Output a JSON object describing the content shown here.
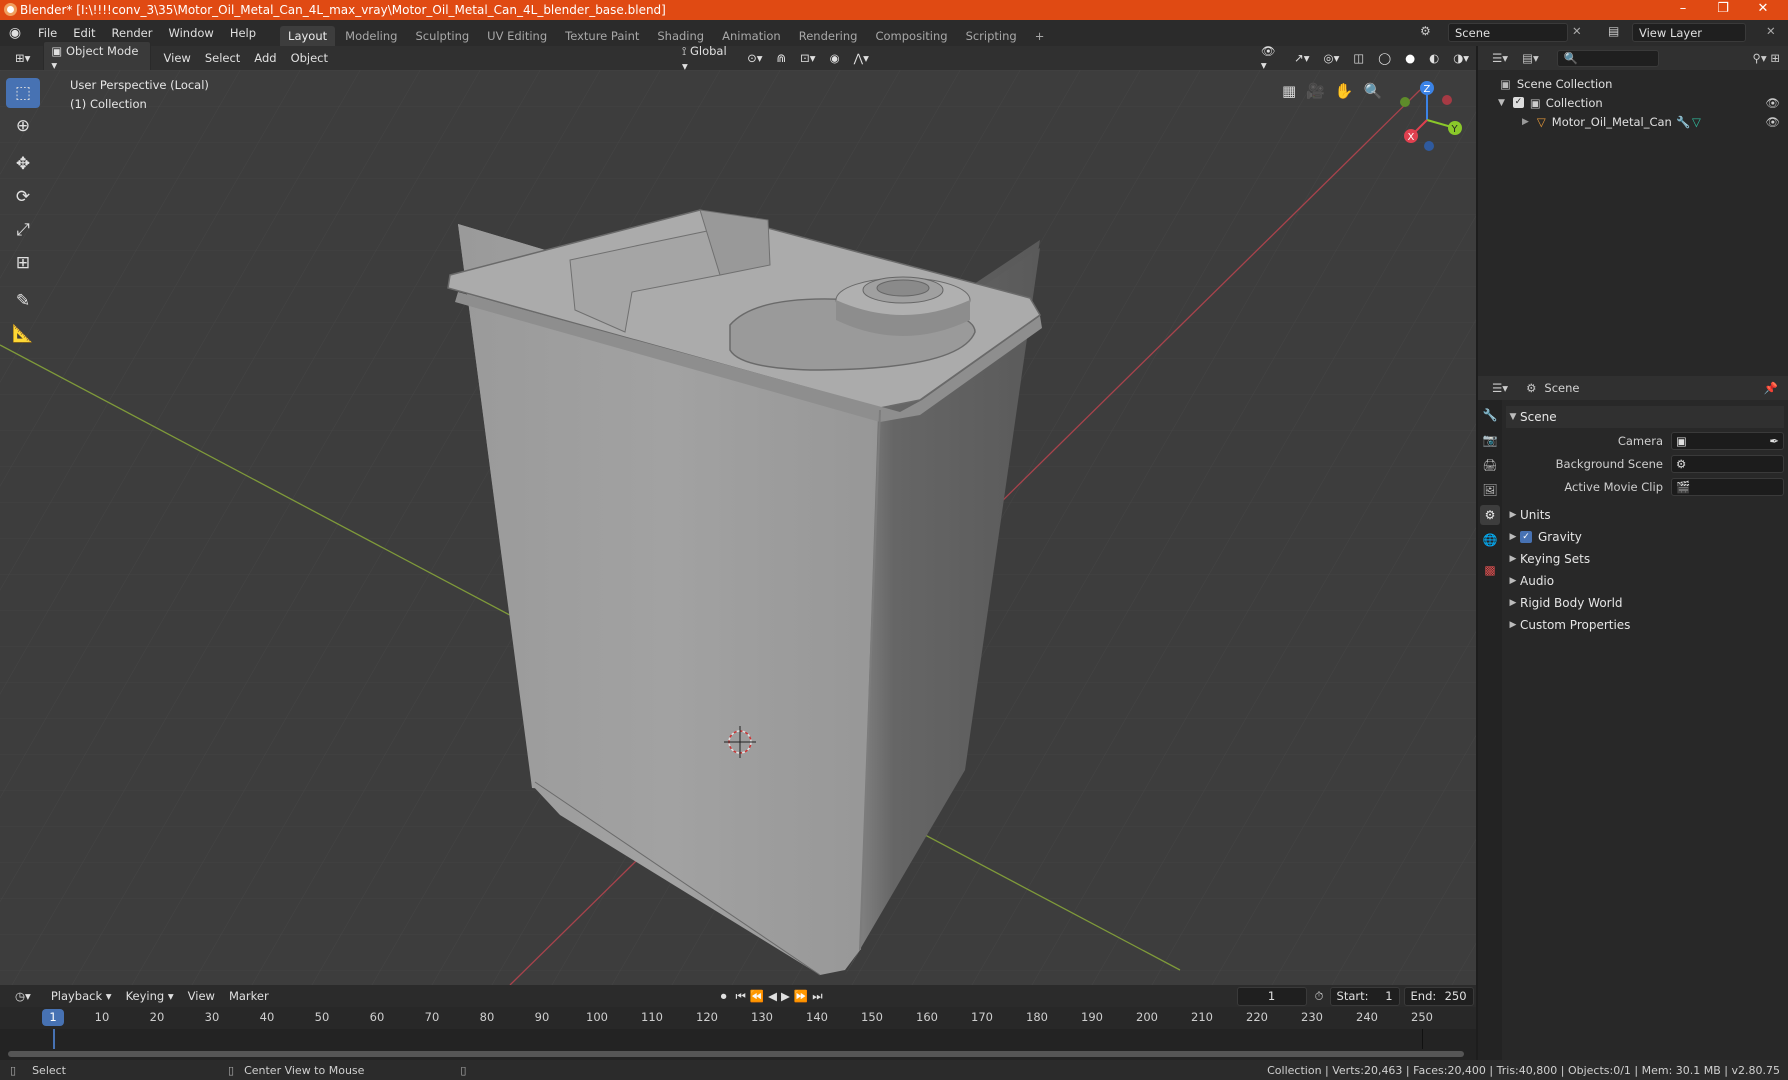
{
  "window": {
    "title": "Blender* [I:\\!!!!conv_3\\35\\Motor_Oil_Metal_Can_4L_max_vray\\Motor_Oil_Metal_Can_4L_blender_base.blend]",
    "minimize": "–",
    "maximize": "❐",
    "close": "✕"
  },
  "menu": {
    "items": [
      "File",
      "Edit",
      "Render",
      "Window",
      "Help"
    ]
  },
  "workspaces": {
    "tabs": [
      "Layout",
      "Modeling",
      "Sculpting",
      "UV Editing",
      "Texture Paint",
      "Shading",
      "Animation",
      "Rendering",
      "Compositing",
      "Scripting"
    ],
    "add": "+"
  },
  "scene_selector": {
    "value": "Scene"
  },
  "view_layer_selector": {
    "value": "View Layer"
  },
  "viewport_header": {
    "mode": "Object Mode",
    "view": "View",
    "select": "Select",
    "add": "Add",
    "object": "Object",
    "orientation": "Global"
  },
  "viewport_info": {
    "line1": "User Perspective (Local)",
    "line2": "(1) Collection"
  },
  "gizmo": {
    "x": "X",
    "y": "Y",
    "z": "Z"
  },
  "outliner": {
    "scene_collection": "Scene Collection",
    "collection": "Collection",
    "object": "Motor_Oil_Metal_Can"
  },
  "properties": {
    "header": "Scene",
    "section": "Scene",
    "camera_label": "Camera",
    "bg_scene_label": "Background Scene",
    "movie_clip_label": "Active Movie Clip",
    "panels": [
      "Units",
      "Gravity",
      "Keying Sets",
      "Audio",
      "Rigid Body World",
      "Custom Properties"
    ]
  },
  "timeline": {
    "playback": "Playback",
    "keying": "Keying",
    "view": "View",
    "marker": "Marker",
    "current_frame": "1",
    "start_label": "Start:",
    "start": "1",
    "end_label": "End:",
    "end": "250",
    "ruler": [
      "1",
      "10",
      "20",
      "30",
      "40",
      "50",
      "60",
      "70",
      "80",
      "90",
      "100",
      "110",
      "120",
      "130",
      "140",
      "150",
      "160",
      "170",
      "180",
      "190",
      "200",
      "210",
      "220",
      "230",
      "240",
      "250"
    ]
  },
  "status": {
    "select": "Select",
    "center": "Center View to Mouse",
    "stats": "Collection | Verts:20,463 | Faces:20,400 | Tris:40,800 | Objects:0/1 | Mem: 30.1 MB | v2.80.75"
  },
  "colors": {
    "accent": "#4772b3",
    "titlebar": "#e04a13",
    "x_axis": "#e0404f",
    "y_axis": "#8ac82a",
    "z_axis": "#3b83e6"
  }
}
